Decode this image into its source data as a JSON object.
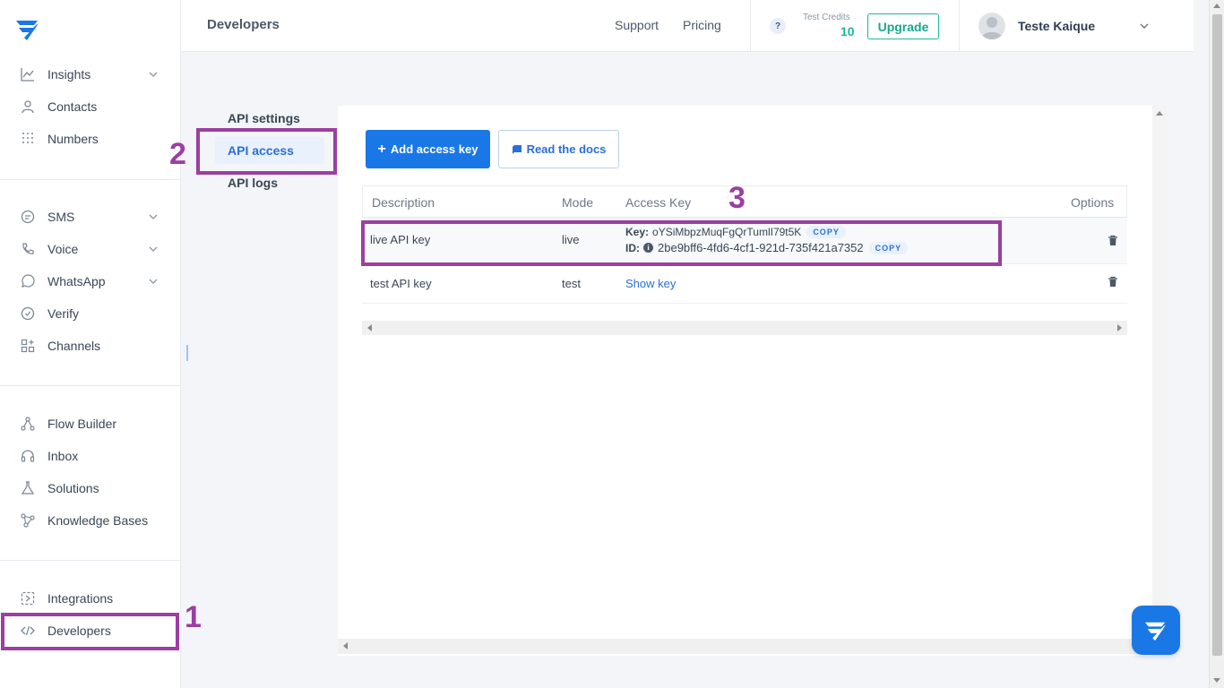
{
  "topbar": {
    "title": "Developers",
    "support": "Support",
    "pricing": "Pricing",
    "help": "?",
    "credits_label": "Test Credits",
    "credits_value": "10",
    "upgrade": "Upgrade",
    "user_name": "Teste Kaique"
  },
  "sidebar": {
    "group1": [
      {
        "label": "Insights",
        "icon": "chart-line-icon",
        "expandable": true
      },
      {
        "label": "Contacts",
        "icon": "user-icon",
        "expandable": false
      },
      {
        "label": "Numbers",
        "icon": "dialpad-icon",
        "expandable": false
      }
    ],
    "group2": [
      {
        "label": "SMS",
        "icon": "chat-bubble-icon",
        "expandable": true
      },
      {
        "label": "Voice",
        "icon": "phone-icon",
        "expandable": true
      },
      {
        "label": "WhatsApp",
        "icon": "whatsapp-icon",
        "expandable": true
      },
      {
        "label": "Verify",
        "icon": "shield-check-icon",
        "expandable": false
      },
      {
        "label": "Channels",
        "icon": "grid-plus-icon",
        "expandable": false
      }
    ],
    "group3": [
      {
        "label": "Flow Builder",
        "icon": "flow-icon"
      },
      {
        "label": "Inbox",
        "icon": "headset-icon"
      },
      {
        "label": "Solutions",
        "icon": "flask-icon"
      },
      {
        "label": "Knowledge Bases",
        "icon": "graph-nodes-icon"
      }
    ],
    "group4": [
      {
        "label": "Integrations",
        "icon": "integration-icon"
      },
      {
        "label": "Developers",
        "icon": "code-icon"
      }
    ]
  },
  "subnav": {
    "items": [
      "API settings",
      "API access",
      "API logs"
    ],
    "active": "API access"
  },
  "actions": {
    "add_key": "Add access key",
    "read_docs": "Read the docs"
  },
  "table": {
    "headers": {
      "description": "Description",
      "mode": "Mode",
      "access_key": "Access Key",
      "options": "Options"
    },
    "rows": [
      {
        "description": "live API key",
        "mode": "live",
        "key_label": "Key:",
        "key_value": "oYSiMbpzMuqFgQrTumlI79t5K",
        "id_label": "ID:",
        "id_value": "2be9bff6-4fd6-4cf1-921d-735f421a7352",
        "copy": "COPY"
      },
      {
        "description": "test API key",
        "mode": "test",
        "show_key": "Show key"
      }
    ]
  },
  "annotations": {
    "n1": "1",
    "n2": "2",
    "n3": "3"
  },
  "colors": {
    "accent": "#1a78e6",
    "brand_green": "#1cb89a",
    "annotation": "#9b3fa0"
  }
}
